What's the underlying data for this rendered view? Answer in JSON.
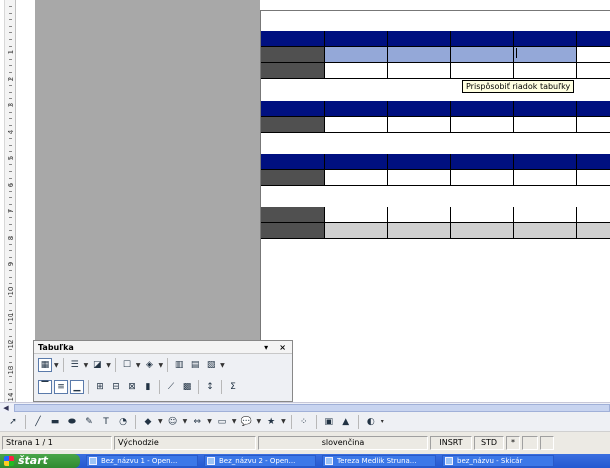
{
  "ruler": {
    "numbers": [
      "1",
      "2",
      "3",
      "4",
      "5",
      "6",
      "7",
      "8",
      "9",
      "10",
      "11",
      "12",
      "13",
      "14"
    ]
  },
  "tooltip": "Prispôsobiť riadok tabuľky",
  "table_toolbar": {
    "title": "Tabuľka",
    "menu_arrow": "▾",
    "close": "×"
  },
  "statusbar": {
    "page": "Strana 1 / 1",
    "style": "Východzie",
    "language": "slovenčina",
    "insert_mode": "INSRT",
    "selection_mode": "STD",
    "modified": "*"
  },
  "taskbar": {
    "start": "štart",
    "tasks": [
      "Bez_názvu 1 - Open...",
      "Bez_názvu 2 - Open...",
      "Tereza Medlik Struna...",
      "bez_názvu - Skicár"
    ]
  },
  "colors": {
    "navy": "#001080",
    "dark_cell": "#505050",
    "selected": "#94a8d8",
    "light_gray": "#d0d0d0"
  }
}
